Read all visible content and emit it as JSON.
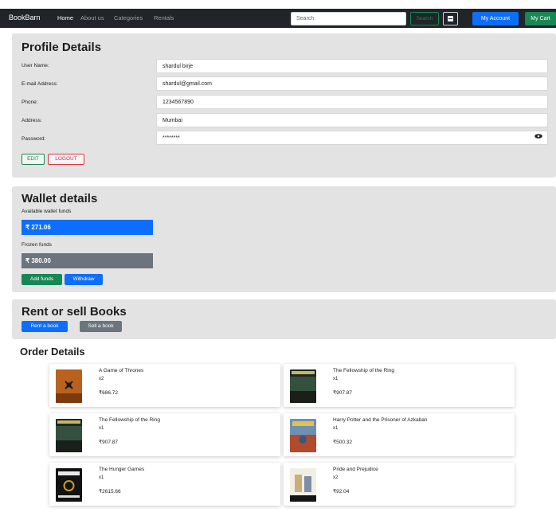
{
  "navbar": {
    "brand": "BookBarn",
    "links": [
      "Home",
      "About us",
      "Categories",
      "Rentals"
    ],
    "search_placeholder": "Search",
    "search_button": "Search",
    "account_button": "My Account",
    "cart_button": "My Cart"
  },
  "profile": {
    "title": "Profile Details",
    "fields": [
      {
        "label": "User Name:",
        "value": "shardul birje"
      },
      {
        "label": "E-mail Address:",
        "value": "shardul@gmail.com"
      },
      {
        "label": "Phone:",
        "value": "1234567890"
      },
      {
        "label": "Address:",
        "value": "Mumbai"
      },
      {
        "label": "Password:",
        "value": "********"
      }
    ],
    "edit_button": "EDIT",
    "logout_button": "LOGOUT"
  },
  "wallet": {
    "title": "Wallet details",
    "available_label": "Available wallet funds",
    "available_amount": "₹ 271.06",
    "frozen_label": "Frozen funds",
    "frozen_amount": "₹ 380.00",
    "add_funds_button": "Add funds",
    "withdraw_button": "Withdraw"
  },
  "rent_sell": {
    "title": "Rent or sell Books",
    "rent_button": "Rent a book",
    "sell_button": "Sell a book"
  },
  "orders": {
    "title": "Order Details",
    "items": [
      {
        "title": "A Game of Thrones",
        "qty": "x2",
        "price": "₹686.72"
      },
      {
        "title": "The Fellowship of the Ring",
        "qty": "x1",
        "price": "₹907.87"
      },
      {
        "title": "The Fellowship of the Ring",
        "qty": "x1",
        "price": "₹907.87"
      },
      {
        "title": "Harry Potter and the Prisoner of Azkaban",
        "qty": "x1",
        "price": "₹500.32"
      },
      {
        "title": "The Hunger Games",
        "qty": "x1",
        "price": "₹2615.66"
      },
      {
        "title": "Pride and Prejudice",
        "qty": "x2",
        "price": "₹92.04"
      }
    ]
  },
  "colors": {
    "navbar": "#212529",
    "primary": "#0d6efd",
    "success": "#198754",
    "danger": "#dc3545",
    "secondary": "#6c757d",
    "panel": "#e3e3e3"
  },
  "icons": [
    "save-icon",
    "eye-icon"
  ]
}
